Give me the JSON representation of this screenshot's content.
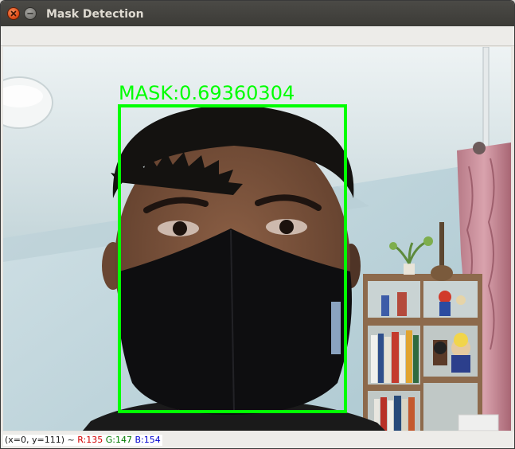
{
  "window": {
    "title": "Mask Detection"
  },
  "detection": {
    "label": "MASK:0.69360304",
    "box_color": "#00ff00"
  },
  "statusbar": {
    "coords": "(x=0, y=111) ~",
    "r": "R:135",
    "g": "G:147",
    "b": "B:154",
    "r_color": "#d40000",
    "g_color": "#007a00",
    "b_color": "#0000d0"
  },
  "icons": {
    "close": "close-icon",
    "minimize": "minimize-icon"
  },
  "colors": {
    "titlebar": "#3c3b37",
    "detection_green": "#00ff00"
  }
}
